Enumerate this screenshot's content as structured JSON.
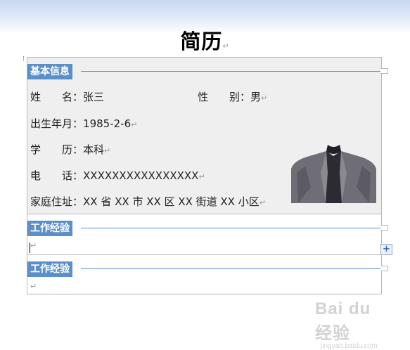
{
  "title": "简历",
  "para_mark": "↵",
  "sections": [
    {
      "heading": "基本信息",
      "fields": [
        {
          "label": "姓　　名",
          "sep": "：",
          "value": "张三"
        },
        {
          "label": "性　　别",
          "sep": "：",
          "value": "男"
        },
        {
          "label": "出生年月",
          "sep": "：",
          "value": "1985-2-6"
        },
        {
          "label": "学　　历",
          "sep": "：",
          "value": "本科"
        },
        {
          "label": "电　　话",
          "sep": "：",
          "value": "XXXXXXXXXXXXXXXX"
        },
        {
          "label": "家庭住址",
          "sep": "：",
          "value": "XX 省 XX 市 XX 区 XX 街道 XX 小区"
        }
      ]
    },
    {
      "heading": "工作经验"
    },
    {
      "heading": "工作经验"
    }
  ],
  "add_button": "+",
  "watermark": {
    "main": "Bai du 经验",
    "sub": "jingyan.baidu.com"
  },
  "colors": {
    "accent": "#5a8fc8",
    "section_bg": "#efefef",
    "top_band": "#c9d6f2"
  }
}
